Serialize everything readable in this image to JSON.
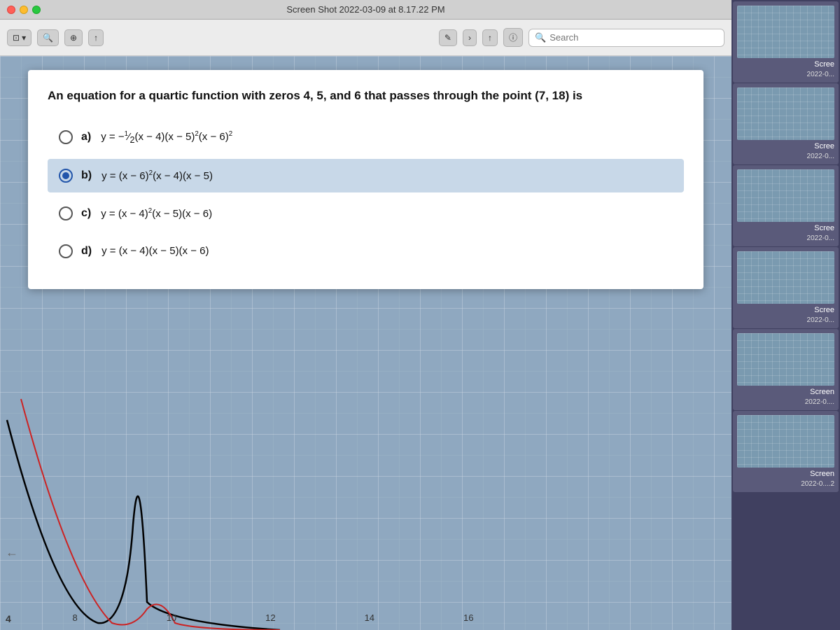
{
  "titlebar": {
    "title": "Screen Shot 2022-03-09 at 8.17.22 PM"
  },
  "toolbar": {
    "search_placeholder": "Search",
    "btn1": "□▾",
    "btn2": "🔍",
    "btn3": "⊕",
    "btn4": "↑"
  },
  "question": {
    "text": "An equation for a quartic function with zeros 4, 5, and 6 that passes through the point (7, 18) is"
  },
  "options": [
    {
      "id": "a",
      "label": "a)",
      "selected": false,
      "math": "y = −½(x − 4)(x − 5)²(x − 6)²"
    },
    {
      "id": "b",
      "label": "b)",
      "selected": true,
      "math": "y = (x − 6)²(x − 4)(x − 5)"
    },
    {
      "id": "c",
      "label": "c)",
      "selected": false,
      "math": "y = (x − 4)²(x − 5)(x − 6)"
    },
    {
      "id": "d",
      "label": "d)",
      "selected": false,
      "math": "y = (x − 4)(x − 5)(x − 6)"
    }
  ],
  "graph": {
    "x_labels": [
      "8",
      "10",
      "12",
      "14",
      "16"
    ]
  },
  "sidebar": {
    "items": [
      {
        "label": "Scree",
        "sublabel": "2022-0..."
      },
      {
        "label": "Scree",
        "sublabel": "2022-0..."
      },
      {
        "label": "Scree",
        "sublabel": "2022-0..."
      },
      {
        "label": "Scree",
        "sublabel": "2022-0..."
      },
      {
        "label": "Screen",
        "sublabel": "2022-0...."
      },
      {
        "label": "Screen",
        "sublabel": "2022-0....2"
      }
    ]
  }
}
